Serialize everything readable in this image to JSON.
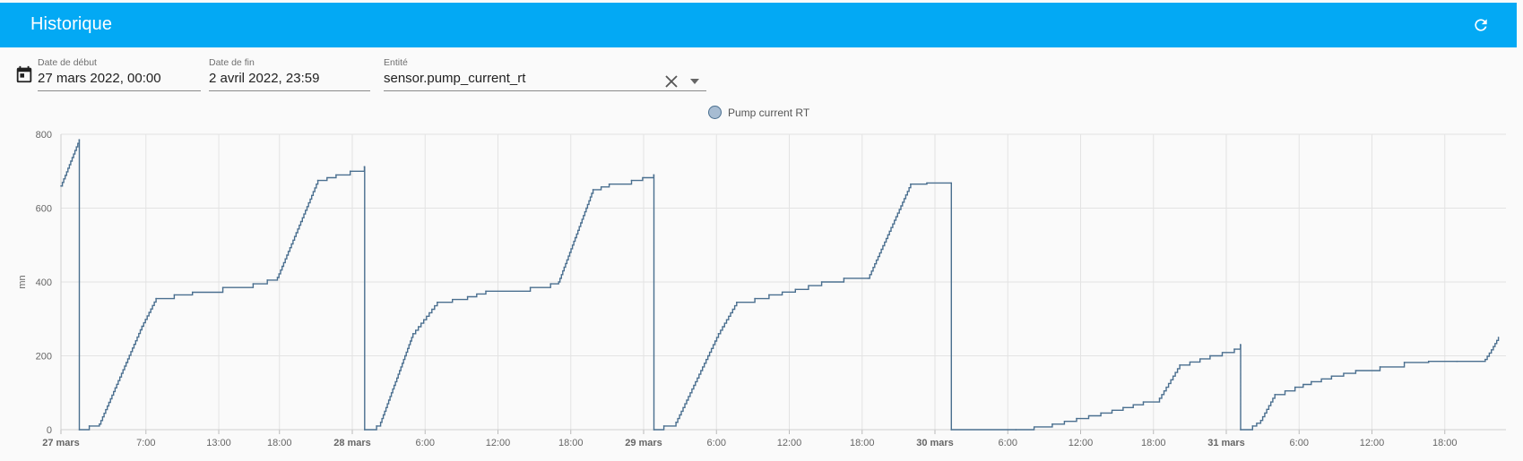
{
  "header": {
    "title": "Historique",
    "refresh_icon": "refresh-icon"
  },
  "filters": {
    "calendar_icon": "calendar-icon",
    "start": {
      "label": "Date de début",
      "value": "27 mars 2022, 00:00"
    },
    "end": {
      "label": "Date de fin",
      "value": "2 avril 2022, 23:59"
    },
    "entity": {
      "label": "Entité",
      "value": "sensor.pump_current_rt",
      "clear_icon": "close-icon",
      "dropdown_icon": "chevron-down-icon"
    }
  },
  "colors": {
    "accent": "#03a9f4",
    "series": "#4a6f8f",
    "series_fill": "#a7bcd2",
    "grid": "#e3e3e3"
  },
  "chart_data": {
    "type": "line",
    "title": "",
    "ylabel": "mn",
    "xlabel": "",
    "ylim": [
      0,
      800
    ],
    "yticks": [
      0,
      200,
      400,
      600,
      800
    ],
    "xlim": [
      "27 mars 00:00",
      "2 avril 23:59"
    ],
    "legend_position": "top-center",
    "grid": true,
    "xticks": [
      {
        "label": "27 mars",
        "bold": true,
        "t": "27 mars 00:00"
      },
      {
        "label": "7:00",
        "bold": false,
        "t": "27 mars 07:00"
      },
      {
        "label": "13:00",
        "bold": false,
        "t": "27 mars 13:00"
      },
      {
        "label": "18:00",
        "bold": false,
        "t": "27 mars 18:00"
      },
      {
        "label": "28 mars",
        "bold": true,
        "t": "28 mars 00:00"
      },
      {
        "label": "6:00",
        "bold": false,
        "t": "28 mars 06:00"
      },
      {
        "label": "12:00",
        "bold": false,
        "t": "28 mars 12:00"
      },
      {
        "label": "18:00",
        "bold": false,
        "t": "28 mars 18:00"
      },
      {
        "label": "29 mars",
        "bold": true,
        "t": "29 mars 00:00"
      },
      {
        "label": "6:00",
        "bold": false,
        "t": "29 mars 06:00"
      },
      {
        "label": "12:00",
        "bold": false,
        "t": "29 mars 12:00"
      },
      {
        "label": "18:00",
        "bold": false,
        "t": "29 mars 18:00"
      },
      {
        "label": "30 mars",
        "bold": true,
        "t": "30 mars 00:00"
      },
      {
        "label": "6:00",
        "bold": false,
        "t": "30 mars 06:00"
      },
      {
        "label": "12:00",
        "bold": false,
        "t": "30 mars 12:00"
      },
      {
        "label": "18:00",
        "bold": false,
        "t": "30 mars 18:00"
      },
      {
        "label": "31 mars",
        "bold": true,
        "t": "31 mars 00:00"
      },
      {
        "label": "6:00",
        "bold": false,
        "t": "31 mars 06:00"
      },
      {
        "label": "12:00",
        "bold": false,
        "t": "31 mars 12:00"
      },
      {
        "label": "18:00",
        "bold": false,
        "t": "31 mars 18:00"
      }
    ],
    "series": [
      {
        "name": "Pump current RT",
        "x": [
          "27 mars 00:00",
          "27 mars 01:30",
          "27 mars 01:31",
          "27 mars 02:20",
          "27 mars 03:10",
          "27 mars 06:40",
          "27 mars 07:50",
          "27 mars 09:20",
          "27 mars 10:50",
          "27 mars 13:20",
          "27 mars 15:50",
          "27 mars 17:00",
          "27 mars 17:50",
          "27 mars 21:10",
          "27 mars 22:40",
          "27 mars 23:50",
          "28 mars 01:00",
          "28 mars 01:01",
          "28 mars 02:00",
          "28 mars 02:20",
          "28 mars 05:00",
          "28 mars 07:00",
          "28 mars 09:30",
          "28 mars 11:00",
          "28 mars 14:40",
          "28 mars 16:20",
          "28 mars 17:00",
          "28 mars 19:50",
          "28 mars 21:10",
          "28 mars 23:00",
          "29 mars 00:50",
          "29 mars 00:51",
          "29 mars 01:40",
          "29 mars 02:40",
          "29 mars 06:10",
          "29 mars 07:40",
          "29 mars 09:10",
          "29 mars 10:20",
          "29 mars 12:30",
          "29 mars 14:40",
          "29 mars 16:30",
          "29 mars 18:30",
          "29 mars 22:00",
          "29 mars 23:20",
          "30 mars 01:20",
          "30 mars 01:21",
          "30 mars 06:40",
          "30 mars 09:40",
          "30 mars 11:40",
          "30 mars 13:40",
          "30 mars 15:30",
          "30 mars 17:10",
          "30 mars 18:30",
          "30 mars 20:10",
          "30 mars 22:40",
          "31 mars 00:40",
          "31 mars 01:10",
          "31 mars 01:11",
          "31 mars 02:10",
          "31 mars 02:50",
          "31 mars 04:00",
          "31 mars 05:40",
          "31 mars 07:00",
          "31 mars 08:40",
          "31 mars 10:40",
          "31 mars 12:40",
          "31 mars 14:40",
          "31 mars 16:40",
          "31 mars 19:00",
          "31 mars 21:20",
          "31 mars 22:00",
          "31 mars 22:25"
        ],
        "y": [
          660,
          785,
          0,
          10,
          15,
          280,
          355,
          365,
          372,
          385,
          395,
          405,
          412,
          675,
          690,
          700,
          712,
          0,
          10,
          20,
          260,
          345,
          360,
          375,
          385,
          395,
          400,
          650,
          665,
          675,
          690,
          0,
          10,
          20,
          260,
          345,
          355,
          365,
          380,
          400,
          410,
          410,
          665,
          668,
          668,
          0,
          0,
          15,
          30,
          45,
          60,
          75,
          85,
          175,
          200,
          218,
          230,
          0,
          10,
          25,
          95,
          115,
          130,
          145,
          160,
          170,
          182,
          185,
          185,
          190,
          225,
          250
        ]
      }
    ]
  }
}
